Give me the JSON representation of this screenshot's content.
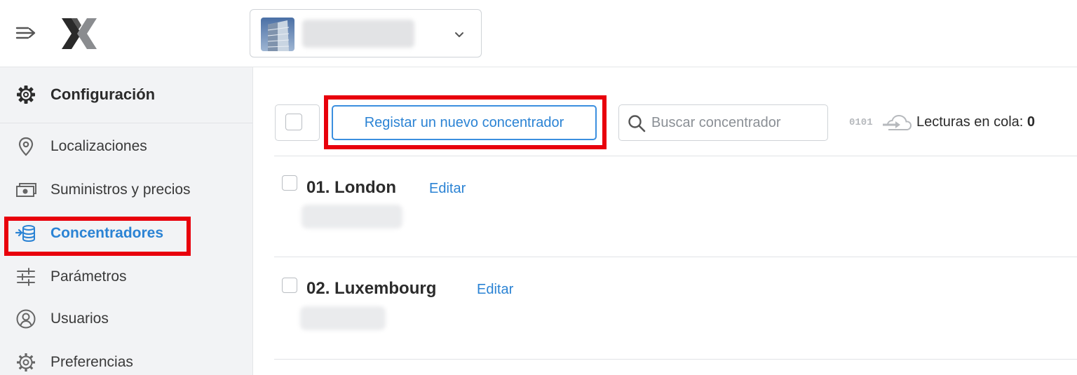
{
  "topbar": {
    "menu_icon": "menu-collapse-icon",
    "logo_icon": "x-logo-icon",
    "org_selector": {
      "thumbnail": "building-thumbnail",
      "chevron_icon": "chevron-down-icon"
    }
  },
  "sidebar": {
    "header": {
      "icon": "gear-icon",
      "label": "Configuración"
    },
    "items": [
      {
        "icon": "location-pin-icon",
        "label": "Localizaciones",
        "active": false
      },
      {
        "icon": "banknote-icon",
        "label": "Suministros y precios",
        "active": false
      },
      {
        "icon": "concentrator-icon",
        "label": "Concentradores",
        "active": true
      },
      {
        "icon": "sliders-icon",
        "label": "Parámetros",
        "active": false
      },
      {
        "icon": "user-circle-icon",
        "label": "Usuarios",
        "active": false
      },
      {
        "icon": "gear-outline-icon",
        "label": "Preferencias",
        "active": false
      }
    ]
  },
  "toolbar": {
    "register_label": "Registar un nuevo concentrador",
    "search_placeholder": "Buscar concentrador",
    "queue": {
      "bits": "0101",
      "label": "Lecturas en cola: ",
      "count": "0"
    }
  },
  "concentrators": [
    {
      "title": "01. London",
      "edit_label": "Editar"
    },
    {
      "title": "02. Luxembourg",
      "edit_label": "Editar"
    }
  ],
  "colors": {
    "accent": "#2b83d4",
    "highlight": "#e8000c",
    "sidebar_bg": "#f2f3f5"
  }
}
